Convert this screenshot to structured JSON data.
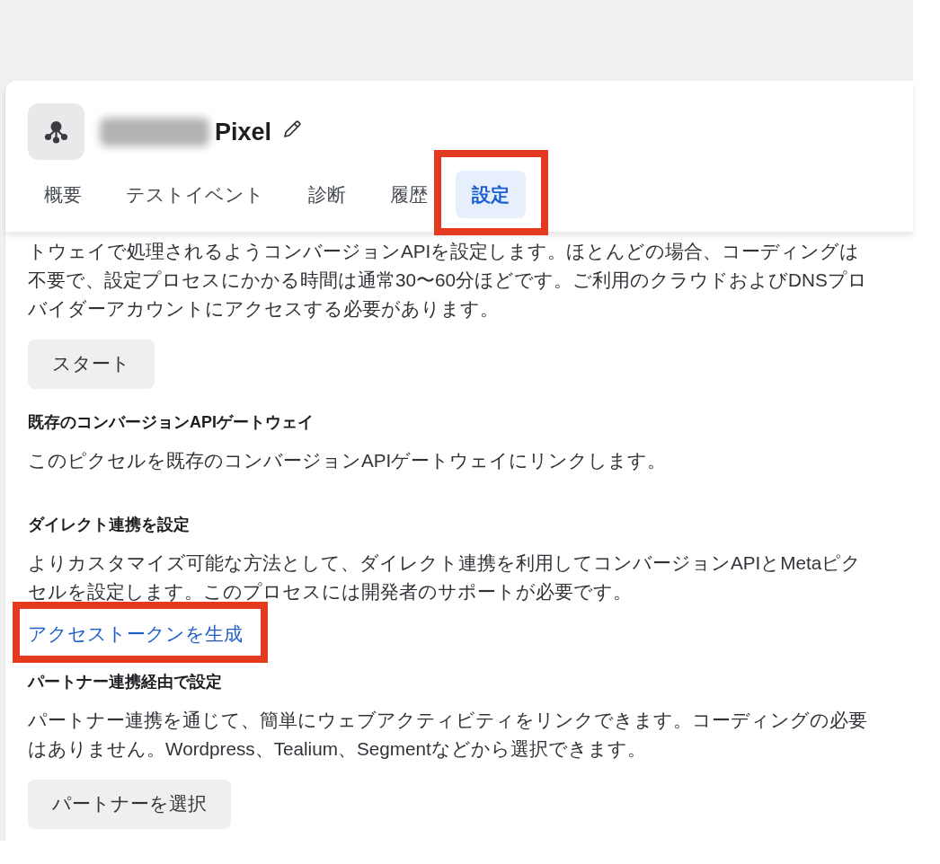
{
  "header": {
    "title": "Pixel"
  },
  "tabs": [
    {
      "label": "概要",
      "selected": false,
      "highlighted": false
    },
    {
      "label": "テストイベント",
      "selected": false,
      "highlighted": false
    },
    {
      "label": "診断",
      "selected": false,
      "highlighted": false
    },
    {
      "label": "履歴",
      "selected": false,
      "highlighted": false
    },
    {
      "label": "設定",
      "selected": true,
      "highlighted": true
    }
  ],
  "sections": [
    {
      "kind": "button",
      "text": "トウェイで処理されるようコンバージョンAPIを設定します。ほとんどの場合、コーディングは不要で、設定プロセスにかかる時間は通常30〜60分ほどです。ご利用のクラウドおよびDNSプロバイダーアカウントにアクセスする必要があります。",
      "button": "スタート"
    },
    {
      "kind": "text",
      "heading": "既存のコンバージョンAPIゲートウェイ",
      "text": "このピクセルを既存のコンバージョンAPIゲートウェイにリンクします。"
    },
    {
      "kind": "link",
      "heading": "ダイレクト連携を設定",
      "text": "よりカスタマイズ可能な方法として、ダイレクト連携を利用してコンバージョンAPIとMetaピクセルを設定します。このプロセスには開発者のサポートが必要です。",
      "link": {
        "label": "アクセストークンを生成",
        "highlighted": true
      }
    },
    {
      "kind": "button",
      "heading": "パートナー連携経由で設定",
      "text": "パートナー連携を通じて、簡単にウェブアクティビティをリンクできます。コーディングの必要はありません。Wordpress、Tealium、Segmentなどから選択できます。",
      "button": "パートナーを選択"
    }
  ]
}
